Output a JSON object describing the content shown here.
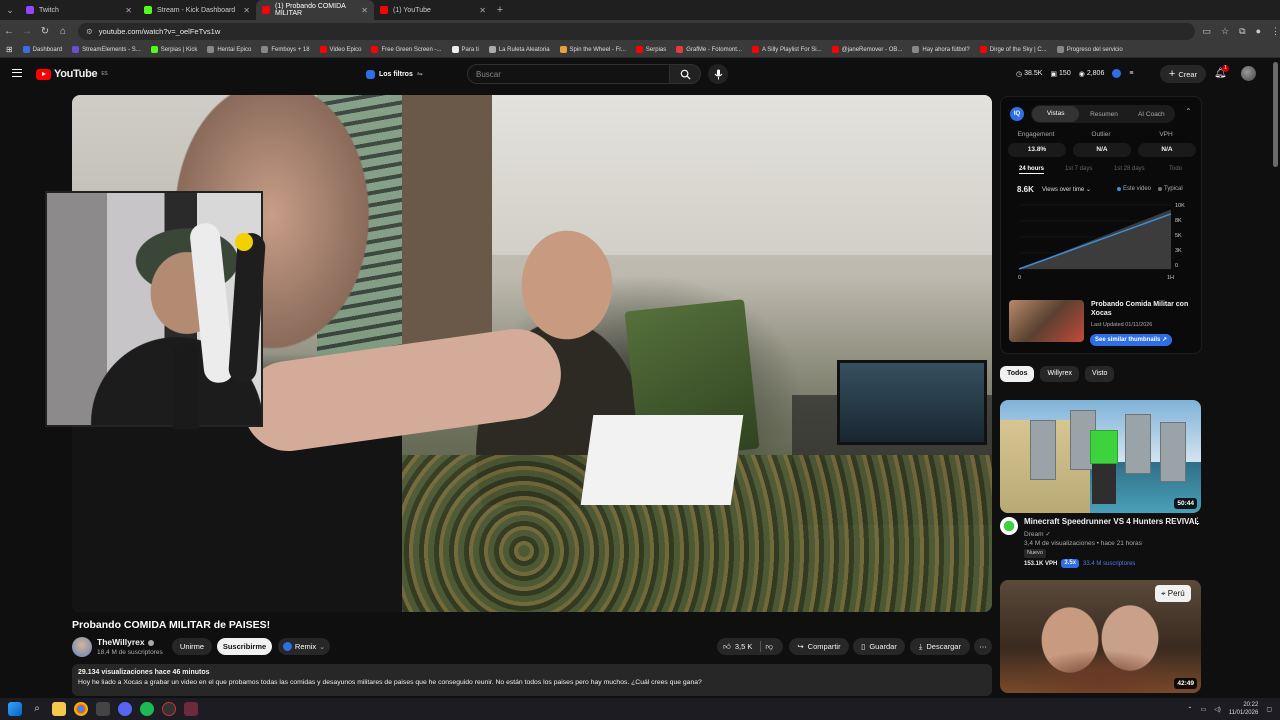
{
  "tabs": [
    {
      "title": "Twitch",
      "color": "#9146ff",
      "active": false
    },
    {
      "title": "Stream - Kick Dashboard",
      "color": "#53fc18",
      "active": false
    },
    {
      "title": "(1) Probando COMIDA MILITAR",
      "color": "#ff0000",
      "active": true
    },
    {
      "title": "(1) YouTube",
      "color": "#ff0000",
      "active": false
    }
  ],
  "address": {
    "url": "youtube.com/watch?v=_oelFeTvs1w"
  },
  "bookmarks": [
    {
      "label": "Dashboard",
      "color": "#3a6ee8"
    },
    {
      "label": "StreamElements - S...",
      "color": "#6b4cd6"
    },
    {
      "label": "Serpias | Kick",
      "color": "#53fc18"
    },
    {
      "label": "Hentai Epico",
      "color": "#888888"
    },
    {
      "label": "Femboys + 18",
      "color": "#888888"
    },
    {
      "label": "Video Epico",
      "color": "#ff0000"
    },
    {
      "label": "Free Green Screen -...",
      "color": "#ff0000"
    },
    {
      "label": "Para ti",
      "color": "#eeeeee"
    },
    {
      "label": "La Ruleta Aleatoria",
      "color": "#aaaaaa"
    },
    {
      "label": "Spin the Wheel - Fr...",
      "color": "#e8a03a"
    },
    {
      "label": "Serpias",
      "color": "#ff0000"
    },
    {
      "label": "GrafMe - Fotomont...",
      "color": "#e83a3a"
    },
    {
      "label": "A Silly Playlist For Si...",
      "color": "#ff0000"
    },
    {
      "label": "@janeRemover - OB...",
      "color": "#ff0000"
    },
    {
      "label": "Hay ahora fútbol?",
      "color": "#888888"
    },
    {
      "label": "Dirge of the Sky | C...",
      "color": "#ff0000"
    },
    {
      "label": "Progreso del servicio",
      "color": "#888888"
    }
  ],
  "header": {
    "logo": "YouTube",
    "region": "ES",
    "filters_label": "Los filtros",
    "search_placeholder": "Buscar",
    "stat_views": "38.5K",
    "stat_videos": "150",
    "stat_subs": "2,806",
    "create_label": "Crear",
    "notif_count": "1"
  },
  "video": {
    "title": "Probando COMIDA MILITAR de PAISES!",
    "channel": "TheWillyrex",
    "subscribers": "18,4 M de suscriptores",
    "join_label": "Unirme",
    "subscribe_label": "Suscribirme",
    "remix_label": "Remix",
    "likes": "3,5 K",
    "share_label": "Compartir",
    "save_label": "Guardar",
    "download_label": "Descargar",
    "desc_stats": "29.134 visualizaciones  hace 46 minutos",
    "desc_text": "Hoy he liado a Xocas a grabar un video en el que probamos todas las comidas y desayunos militares de paises que he conseguido reunir. No están todos los paises pero hay muchos. ¿Cuál crees que gana?"
  },
  "vidiq": {
    "logo": "IQ",
    "tabs": [
      "Vistas",
      "Resumen",
      "AI Coach"
    ],
    "metrics": [
      {
        "label": "Engagement",
        "value": "13.8%"
      },
      {
        "label": "Outlier",
        "value": "N/A"
      },
      {
        "label": "VPH",
        "value": "N/A"
      }
    ],
    "periods": [
      "24 hours",
      "1st 7 days",
      "1st 28 days",
      "Todo"
    ],
    "views_total": "8.6K",
    "views_mode": "Views over time",
    "legend_this": "Este video",
    "legend_typical": "Typical",
    "y_ticks": [
      "10K",
      "8K",
      "5K",
      "3K",
      "0"
    ],
    "x_ticks": [
      "0",
      "1H"
    ],
    "chart_data": {
      "type": "line",
      "x": [
        0,
        1
      ],
      "series": [
        {
          "name": "Este video",
          "values": [
            0,
            8600
          ]
        }
      ],
      "ylim": [
        0,
        10000
      ],
      "typical_band": [
        0,
        9300
      ]
    },
    "related_title": "Probando Comida Militar con Xocas",
    "related_updated": "Last Updated 01/11/2026",
    "similar_label": "See similar thumbnails"
  },
  "chips": [
    "Todos",
    "Willyrex",
    "Visto"
  ],
  "recs": [
    {
      "title": "Minecraft Speedrunner VS 4 Hunters REVIVAL",
      "channel": "Dream",
      "meta": "3,4 M de visualizaciones • hace 21 horas",
      "badge": "Nuevo",
      "vph": "153.1K VPH",
      "mult": "3.5x",
      "subs": "33.4 M suscriptores",
      "duration": "50:44"
    },
    {
      "tag": "Perú",
      "duration": "42:49"
    }
  ],
  "clock": {
    "time": "20:22",
    "date": "11/01/2026"
  }
}
